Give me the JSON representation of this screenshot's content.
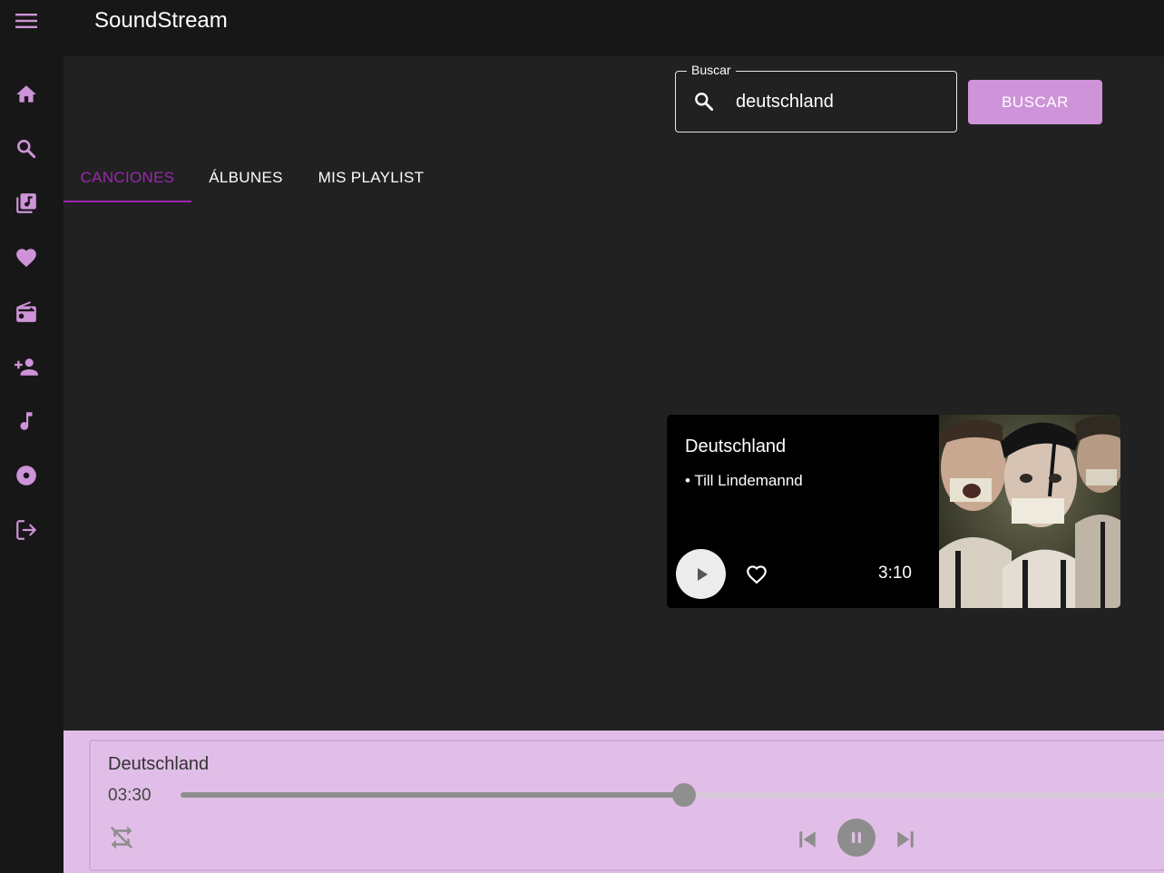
{
  "app": {
    "title": "SoundStream"
  },
  "sidebar": {
    "items": [
      {
        "icon": "home-icon"
      },
      {
        "icon": "search-icon"
      },
      {
        "icon": "library-music-icon"
      },
      {
        "icon": "heart-icon"
      },
      {
        "icon": "radio-icon"
      },
      {
        "icon": "person-add-icon"
      },
      {
        "icon": "music-note-icon"
      },
      {
        "icon": "album-icon"
      },
      {
        "icon": "logout-icon"
      }
    ],
    "accent": "#ce93d8"
  },
  "search": {
    "label": "Buscar",
    "value": "deutschland",
    "button_label": "BUSCAR"
  },
  "tabs": [
    {
      "label": "CANCIONES",
      "active": true
    },
    {
      "label": "ÁLBUNES",
      "active": false
    },
    {
      "label": "MIS PLAYLIST",
      "active": false
    }
  ],
  "results": [
    {
      "title": "Deutschland",
      "artist": "• Till Lindemannd",
      "duration": "3:10"
    }
  ],
  "player": {
    "title": "Deutschland",
    "elapsed": "03:30",
    "progress_fraction": 0.5
  },
  "colors": {
    "background": "#212121",
    "bar": "#171717",
    "accent": "#ce93d8",
    "tab_active": "#9c27b0",
    "player_bg": "#e1bee7"
  }
}
